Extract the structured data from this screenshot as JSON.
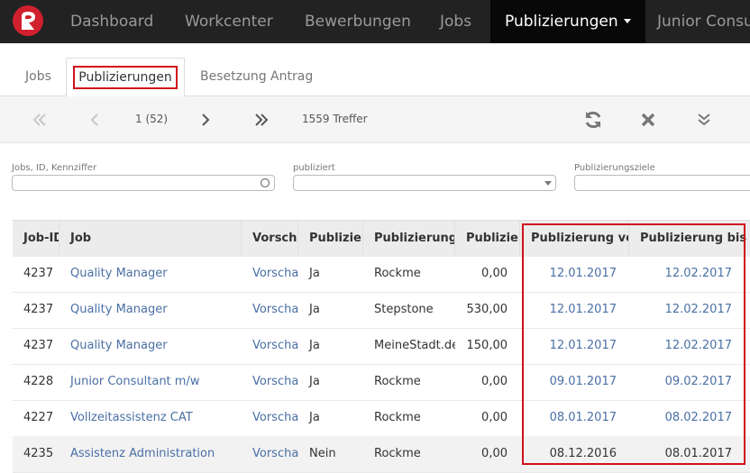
{
  "topnav": {
    "items": [
      {
        "label": "Dashboard"
      },
      {
        "label": "Workcenter"
      },
      {
        "label": "Bewerbungen"
      },
      {
        "label": "Jobs"
      },
      {
        "label": "Publizierungen"
      },
      {
        "label": "Junior Consu"
      }
    ],
    "active_index": 4,
    "logo": "brand-logo"
  },
  "tabs": [
    {
      "label": "Jobs"
    },
    {
      "label": "Publizierungen",
      "active": true
    },
    {
      "label": "Besetzung Antrag"
    }
  ],
  "toolbar": {
    "page_info": "1 (52)",
    "hits": "1559 Treffer",
    "icons": [
      "first-page-icon",
      "prev-page-icon",
      "next-page-icon",
      "last-page-icon",
      "refresh-icon",
      "clear-icon",
      "expand-icon"
    ]
  },
  "filters": [
    {
      "label": "Jobs, ID, Kennziffer",
      "value": ""
    },
    {
      "label": "publiziert",
      "value": ""
    },
    {
      "label": "Publizierungsziele",
      "value": ""
    }
  ],
  "table": {
    "columns": [
      "Job-ID",
      "Job",
      "Vorscha",
      "Publiziert",
      "Publizierung Z",
      "Publizieru",
      "Publizierung von",
      "Publizierung bis"
    ],
    "rows": [
      {
        "id": "4237",
        "job": "Quality Manager",
        "vorschau": "Vorscha",
        "publiziert": "Ja",
        "ziel": "Rockme",
        "kosten": "0,00",
        "von": "12.01.2017",
        "bis": "12.02.2017"
      },
      {
        "id": "4237",
        "job": "Quality Manager",
        "vorschau": "Vorscha",
        "publiziert": "Ja",
        "ziel": "Stepstone",
        "kosten": "530,00",
        "von": "12.01.2017",
        "bis": "12.02.2017"
      },
      {
        "id": "4237",
        "job": "Quality Manager",
        "vorschau": "Vorscha",
        "publiziert": "Ja",
        "ziel": "MeineStadt.de",
        "kosten": "150,00",
        "von": "12.01.2017",
        "bis": "12.02.2017"
      },
      {
        "id": "4228",
        "job": "Junior Consultant m/w",
        "vorschau": "Vorscha",
        "publiziert": "Ja",
        "ziel": "Rockme",
        "kosten": "0,00",
        "von": "09.01.2017",
        "bis": "09.02.2017"
      },
      {
        "id": "4227",
        "job": "Vollzeitassistenz CAT",
        "vorschau": "Vorscha",
        "publiziert": "Ja",
        "ziel": "Rockme",
        "kosten": "0,00",
        "von": "08.01.2017",
        "bis": "08.02.2017"
      },
      {
        "id": "4235",
        "job": "Assistenz Administration",
        "vorschau": "Vorscha",
        "publiziert": "Nein",
        "ziel": "Rockme",
        "kosten": "0,00",
        "von": "08.12.2016",
        "bis": "08.01.2017"
      }
    ]
  },
  "colors": {
    "accent": "#d0101a",
    "link": "#4a6fa5",
    "nav_bg": "#222222"
  }
}
